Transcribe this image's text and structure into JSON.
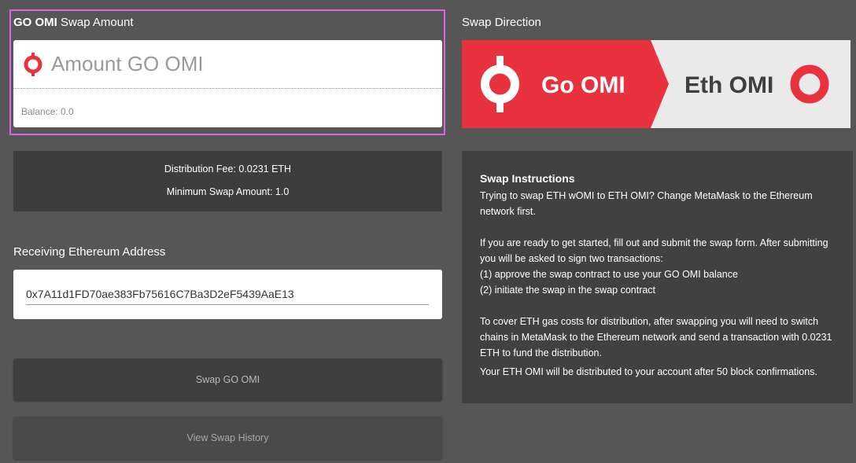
{
  "swap_amount": {
    "title_bold": "GO OMI",
    "title_rest": " Swap Amount",
    "placeholder": "Amount GO OMI",
    "balance": "Balance: 0.0",
    "icon": "omi-logo-icon"
  },
  "fees": {
    "distribution_fee": "Distribution Fee: 0.0231 ETH",
    "minimum_swap": "Minimum Swap Amount: 1.0"
  },
  "receiving": {
    "label": "Receiving Ethereum Address",
    "address": "0x7A11d1FD70ae383Fb75616C7Ba3D2eF5439AaE13"
  },
  "buttons": {
    "swap": "Swap GO OMI",
    "history": "View Swap History"
  },
  "direction": {
    "label": "Swap Direction",
    "from": "Go OMI",
    "to": "Eth OMI",
    "from_color": "#e8333f",
    "to_color": "#eaeaea"
  },
  "instructions": {
    "title": "Swap Instructions",
    "para1": "Trying to swap ETH wOMI to ETH OMI? Change MetaMask to the Ethereum network first.",
    "para2_lines": [
      "If you are ready to get started, fill out and submit the swap form. After submitting you will be asked to sign two transactions:",
      "(1) approve the swap contract to use your GO OMI balance",
      "(2) initiate the swap in the swap contract"
    ],
    "para3": "To cover ETH gas costs for distribution, after swapping you will need to switch chains in MetaMask to the Ethereum network and send a transaction with 0.0231 ETH to fund the distribution.",
    "para4": "Your ETH OMI will be distributed to your account after 50 block confirmations."
  }
}
